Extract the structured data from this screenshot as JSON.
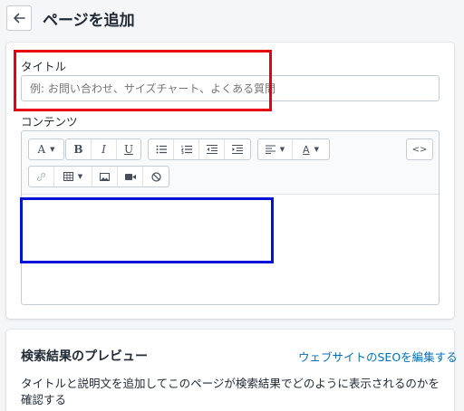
{
  "header": {
    "title": "ページを追加",
    "back_icon": "arrow-left-icon"
  },
  "form": {
    "title_label": "タイトル",
    "title_placeholder": "例: お問い合わせ、サイズチャート、よくある質問",
    "title_value": "",
    "content_label": "コンテンツ",
    "content_value": ""
  },
  "toolbar": {
    "font_button": "A",
    "bold": "B",
    "italic": "I",
    "underline": "U",
    "text_color": "A",
    "html_toggle": "<>",
    "icons": [
      "font-dropdown-icon",
      "bold-icon",
      "italic-icon",
      "underline-icon",
      "bullet-list-icon",
      "numbered-list-icon",
      "outdent-icon",
      "indent-icon",
      "align-dropdown-icon",
      "text-color-dropdown-icon",
      "html-icon",
      "link-icon",
      "table-dropdown-icon",
      "image-icon",
      "video-icon",
      "clear-format-icon"
    ]
  },
  "seo": {
    "heading": "検索結果のプレビュー",
    "edit_link": "ウェブサイトのSEOを編集する",
    "description": "タイトルと説明文を追加してこのページが検索結果でどのように表示されるのかを確認する"
  },
  "colors": {
    "highlight_red": "#e60012",
    "highlight_blue": "#0012d6",
    "link": "#006fbb"
  }
}
